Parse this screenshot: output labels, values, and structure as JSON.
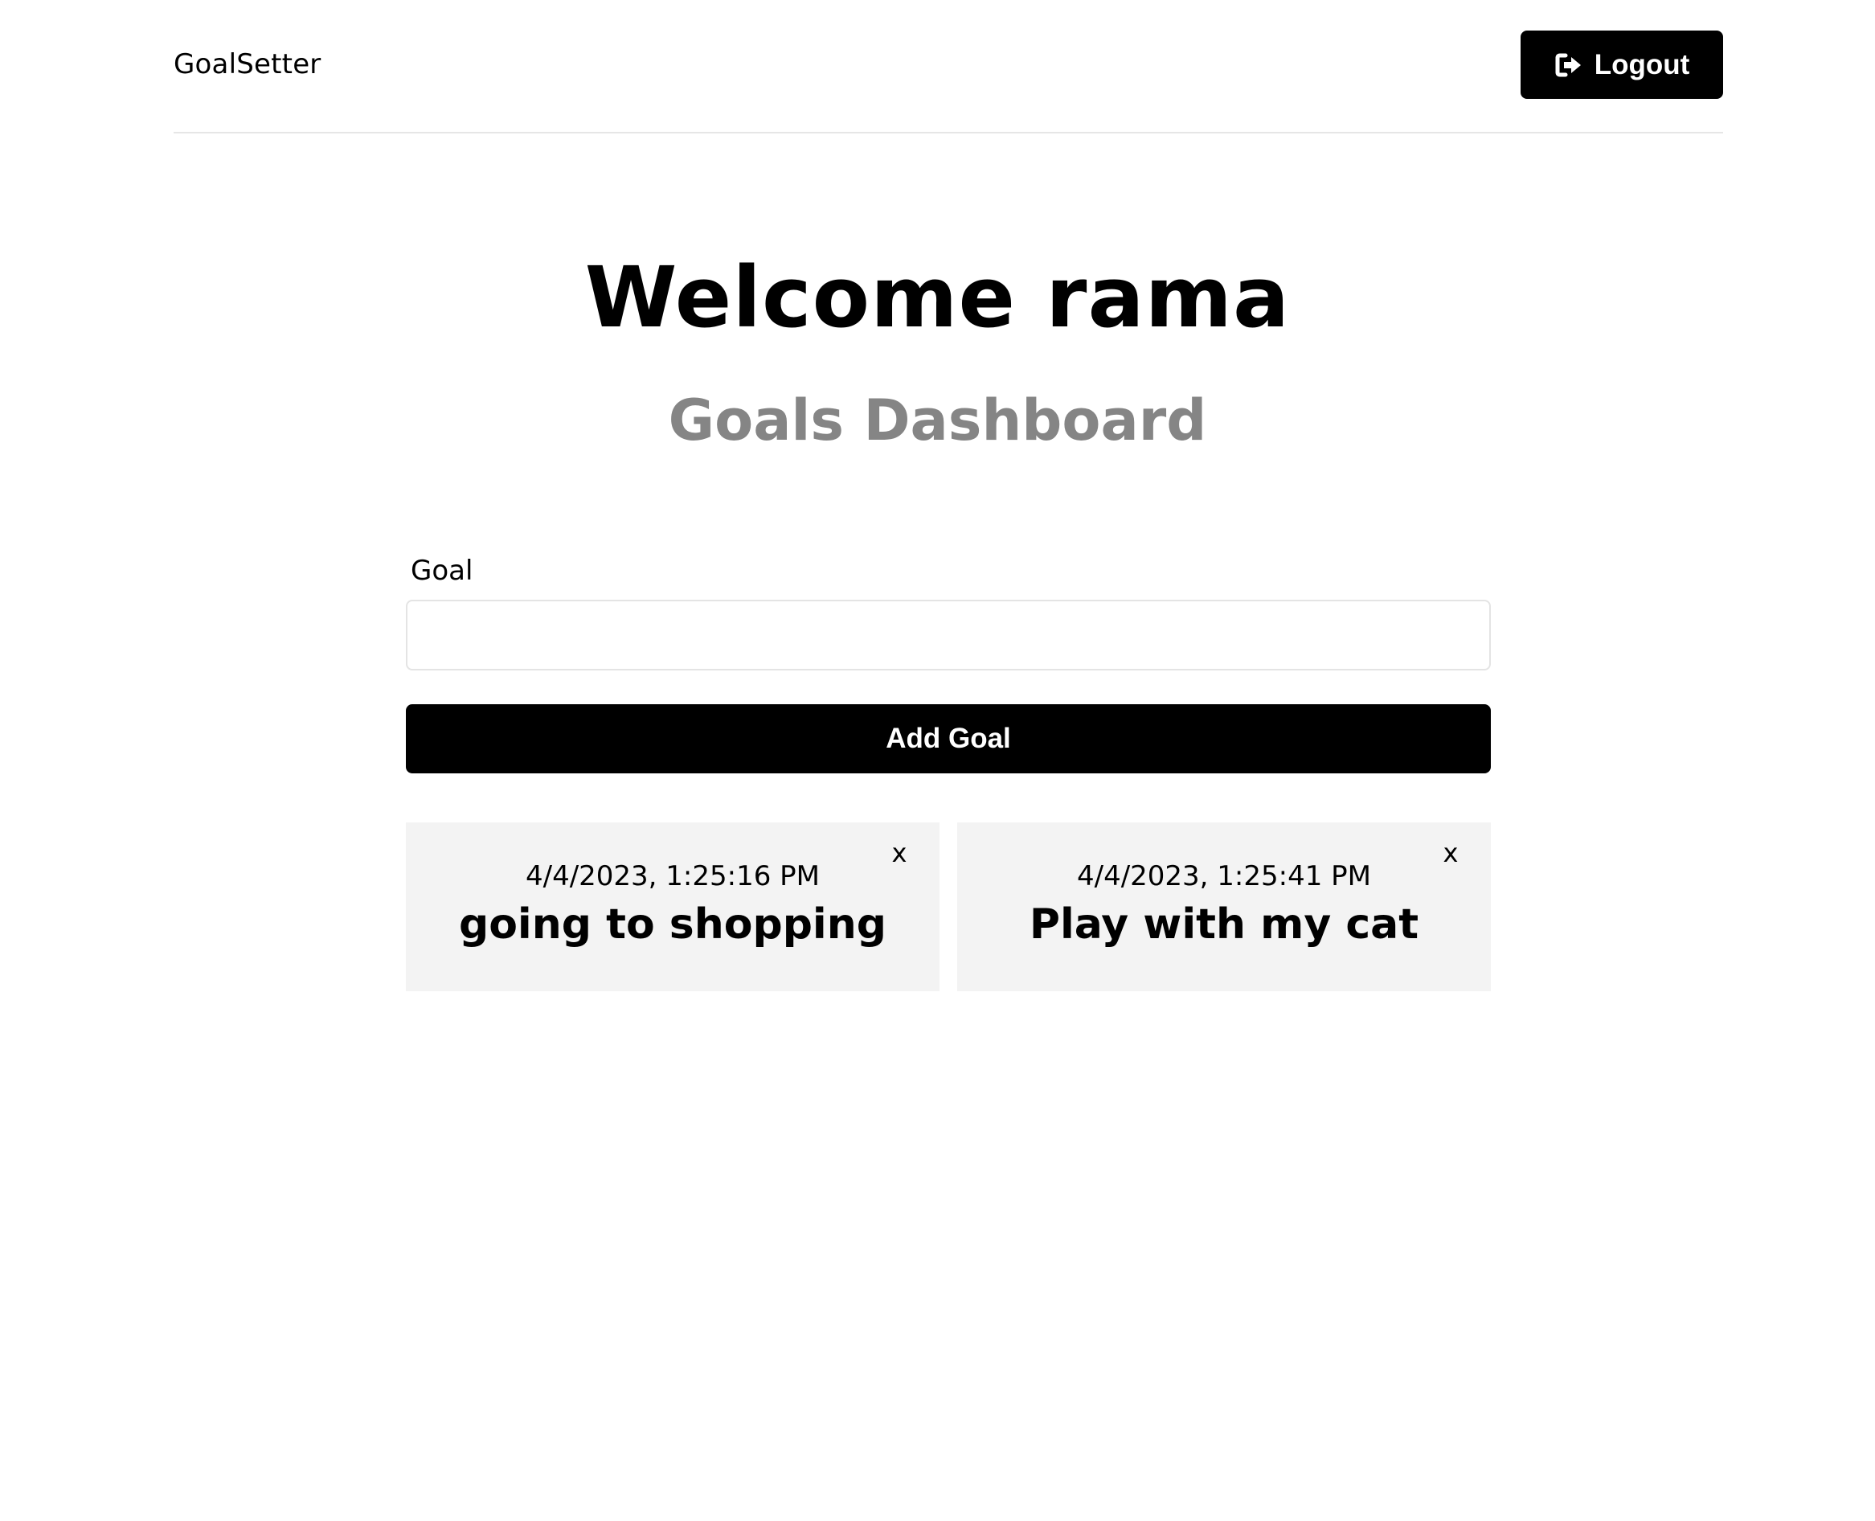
{
  "header": {
    "app_name": "GoalSetter",
    "logout_label": "Logout",
    "logout_icon": "sign-out-icon"
  },
  "main": {
    "welcome": "Welcome rama",
    "subtitle": "Goals Dashboard"
  },
  "form": {
    "goal_label": "Goal",
    "goal_value": "",
    "add_button_label": "Add Goal"
  },
  "goals": [
    {
      "date": "4/4/2023, 1:25:16 PM",
      "text": "going to shopping",
      "close_label": "x"
    },
    {
      "date": "4/4/2023, 1:25:41 PM",
      "text": "Play with my cat",
      "close_label": "x"
    }
  ],
  "colors": {
    "primary": "#000000",
    "subtitle": "#858585",
    "card_bg": "#f3f3f3",
    "divider": "#e6e6e6"
  }
}
